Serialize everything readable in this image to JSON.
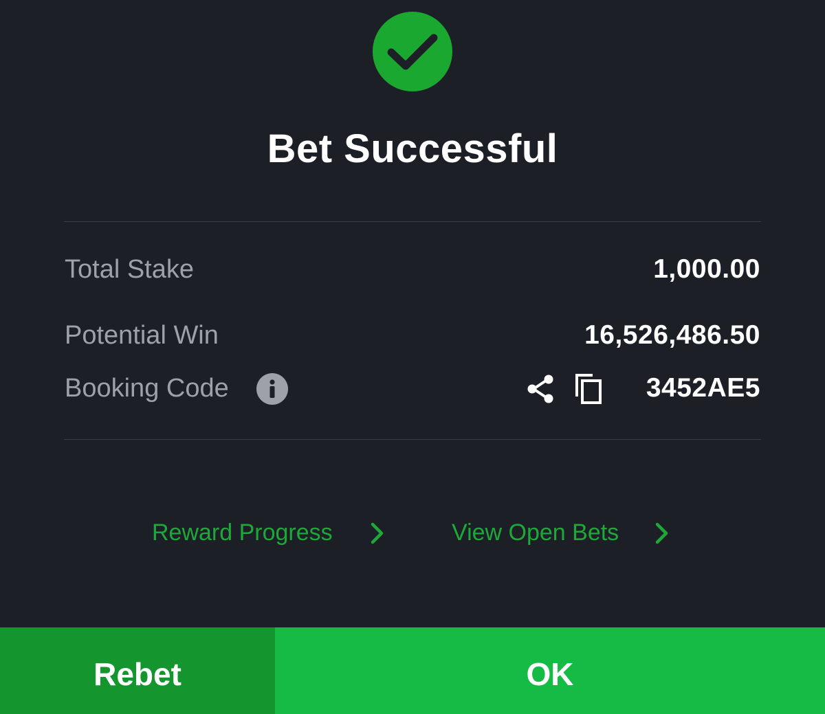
{
  "dialog": {
    "status_icon": "checkmark-circle-icon",
    "title": "Bet Successful"
  },
  "summary": {
    "total_stake_label": "Total Stake",
    "total_stake_value": "1,000.00",
    "potential_win_label": "Potential Win",
    "potential_win_value": "16,526,486.50",
    "booking_code_label": "Booking Code",
    "booking_code_value": "3452AE5",
    "booking_icons": [
      "info-icon",
      "share-icon",
      "copy-icon"
    ]
  },
  "links": {
    "reward_progress": "Reward Progress",
    "view_open_bets": "View Open Bets"
  },
  "footer": {
    "rebet_label": "Rebet",
    "ok_label": "OK"
  },
  "colors": {
    "background": "#1c1f26",
    "accent_green": "#15bb44",
    "rebet_green": "#14952e",
    "link_green": "#1fa83a",
    "label_gray": "#9ea1a9"
  }
}
